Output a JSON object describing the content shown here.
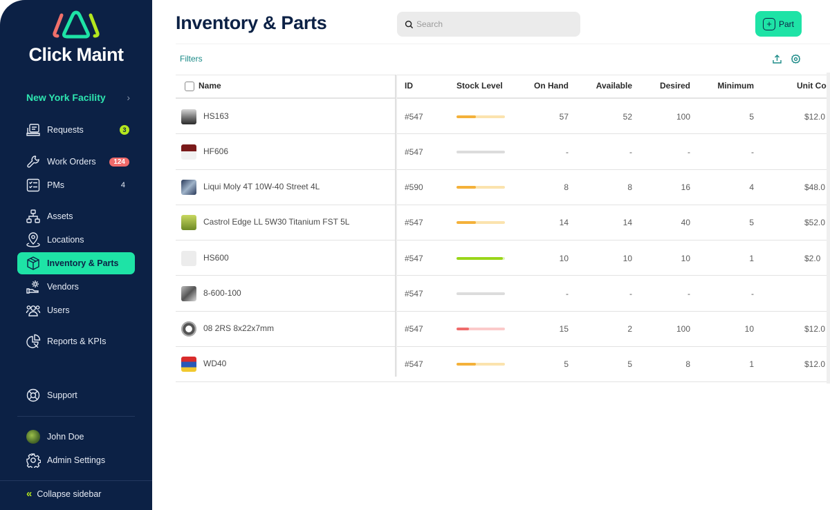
{
  "brand": {
    "name": "Click Maint",
    "colors": {
      "coral": "#f0706a",
      "teal": "#1ee3a6",
      "lime": "#b4e61e",
      "navy": "#0c2145"
    }
  },
  "sidebar": {
    "facility": "New York Facility",
    "items": [
      {
        "label": "Requests",
        "icon": "requests-icon",
        "badge": "3",
        "badge_style": "lime"
      },
      {
        "label": "Work Orders",
        "icon": "wrench-icon",
        "badge": "124",
        "badge_style": "red"
      },
      {
        "label": "PMs",
        "icon": "checklist-icon",
        "badge": "4",
        "badge_style": "plain"
      },
      {
        "label": "Assets",
        "icon": "hierarchy-icon"
      },
      {
        "label": "Locations",
        "icon": "location-pin-icon"
      },
      {
        "label": "Inventory & Parts",
        "icon": "box-icon",
        "active": true
      },
      {
        "label": "Vendors",
        "icon": "vendor-icon"
      },
      {
        "label": "Users",
        "icon": "users-icon"
      },
      {
        "label": "Reports & KPIs",
        "icon": "pie-chart-icon"
      }
    ],
    "support": "Support",
    "user": "John Doe",
    "admin": "Admin Settings",
    "collapse": "Collapse sidebar"
  },
  "header": {
    "title": "Inventory & Parts",
    "search_placeholder": "Search",
    "add_button": "Part",
    "filters": "Filters"
  },
  "table": {
    "columns": [
      "Name",
      "ID",
      "Stock Level",
      "On Hand",
      "Available",
      "Desired",
      "Minimum",
      "Unit Cost"
    ],
    "rows": [
      {
        "name": "HS163",
        "thumb": "metal-part",
        "id": "#547",
        "stock": {
          "level": 0.4,
          "status": "warning"
        },
        "on_hand": "57",
        "available": "52",
        "desired": "100",
        "minimum": "5",
        "unit_cost": "$12.0"
      },
      {
        "name": "HF606",
        "thumb": "filter-part",
        "id": "#547",
        "stock": {
          "level": 0,
          "status": "none"
        },
        "on_hand": "-",
        "available": "-",
        "desired": "-",
        "minimum": "-",
        "unit_cost": ""
      },
      {
        "name": "Liqui Moly 4T 10W-40 Street 4L",
        "thumb": "oil-can",
        "id": "#590",
        "stock": {
          "level": 0.4,
          "status": "warning"
        },
        "on_hand": "8",
        "available": "8",
        "desired": "16",
        "minimum": "4",
        "unit_cost": "$48.0"
      },
      {
        "name": "Castrol Edge LL 5W30 Titanium FST 5L",
        "thumb": "oil-bottle",
        "id": "#547",
        "stock": {
          "level": 0.4,
          "status": "warning"
        },
        "on_hand": "14",
        "available": "14",
        "desired": "40",
        "minimum": "5",
        "unit_cost": "$52.0"
      },
      {
        "name": "HS600",
        "thumb": "placeholder-image",
        "id": "#547",
        "stock": {
          "level": 0.95,
          "status": "good"
        },
        "on_hand": "10",
        "available": "10",
        "desired": "10",
        "minimum": "1",
        "unit_cost": "$2.0"
      },
      {
        "name": "8-600-100",
        "thumb": "machine-part",
        "id": "#547",
        "stock": {
          "level": 0,
          "status": "none"
        },
        "on_hand": "-",
        "available": "-",
        "desired": "-",
        "minimum": "-",
        "unit_cost": ""
      },
      {
        "name": "08 2RS 8x22x7mm",
        "thumb": "bearing",
        "id": "#547",
        "stock": {
          "level": 0.25,
          "status": "critical"
        },
        "on_hand": "15",
        "available": "2",
        "desired": "100",
        "minimum": "10",
        "unit_cost": "$12.0"
      },
      {
        "name": "WD40",
        "thumb": "spray-can",
        "id": "#547",
        "stock": {
          "level": 0.4,
          "status": "warning"
        },
        "on_hand": "5",
        "available": "5",
        "desired": "8",
        "minimum": "1",
        "unit_cost": "$12.0"
      }
    ]
  },
  "stock_colors": {
    "warning": {
      "fill": "#f4b13a",
      "track": "#fbe3ae"
    },
    "good": {
      "fill": "#9ad61a",
      "track": "#dff3b4"
    },
    "critical": {
      "fill": "#ef6b6b",
      "track": "#fbcaca"
    },
    "none": {
      "fill": "#dcdcdc",
      "track": "#dcdcdc"
    }
  }
}
